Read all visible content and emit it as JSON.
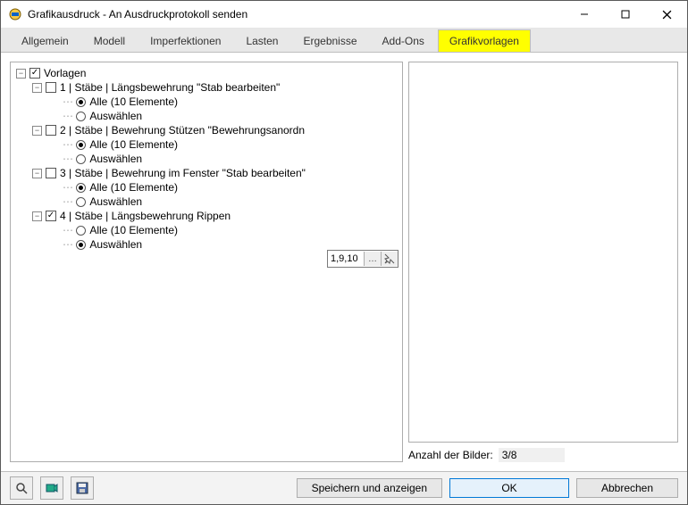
{
  "window": {
    "title": "Grafikausdruck - An Ausdruckprotokoll senden"
  },
  "tabs": {
    "items": [
      "Allgemein",
      "Modell",
      "Imperfektionen",
      "Lasten",
      "Ergebnisse",
      "Add-Ons",
      "Grafikvorlagen"
    ],
    "active_index": 6
  },
  "tree": {
    "root_label": "Vorlagen",
    "items": [
      {
        "label": "1 | Stäbe | Längsbewehrung \"Stab bearbeiten\"",
        "checked": false,
        "options": [
          {
            "label": "Alle (10 Elemente)",
            "selected": true
          },
          {
            "label": "Auswählen",
            "selected": false
          }
        ]
      },
      {
        "label": "2 | Stäbe | Bewehrung Stützen \"Bewehrungsanordn",
        "checked": false,
        "options": [
          {
            "label": "Alle (10 Elemente)",
            "selected": true
          },
          {
            "label": "Auswählen",
            "selected": false
          }
        ]
      },
      {
        "label": "3 | Stäbe | Bewehrung im Fenster \"Stab bearbeiten\"",
        "checked": false,
        "options": [
          {
            "label": "Alle (10 Elemente)",
            "selected": true
          },
          {
            "label": "Auswählen",
            "selected": false
          }
        ]
      },
      {
        "label": "4 | Stäbe | Längsbewehrung Rippen",
        "checked": true,
        "options": [
          {
            "label": "Alle (10 Elemente)",
            "selected": false
          },
          {
            "label": "Auswählen",
            "selected": true
          }
        ]
      }
    ],
    "selection_value": "1,9,10"
  },
  "right": {
    "count_label": "Anzahl der Bilder:",
    "count_value": "3/8"
  },
  "footer": {
    "save_show": "Speichern und anzeigen",
    "ok": "OK",
    "cancel": "Abbrechen"
  },
  "icons": {
    "app": "app-icon",
    "search": "search-icon",
    "quick": "quickview-icon",
    "save": "save-icon"
  }
}
